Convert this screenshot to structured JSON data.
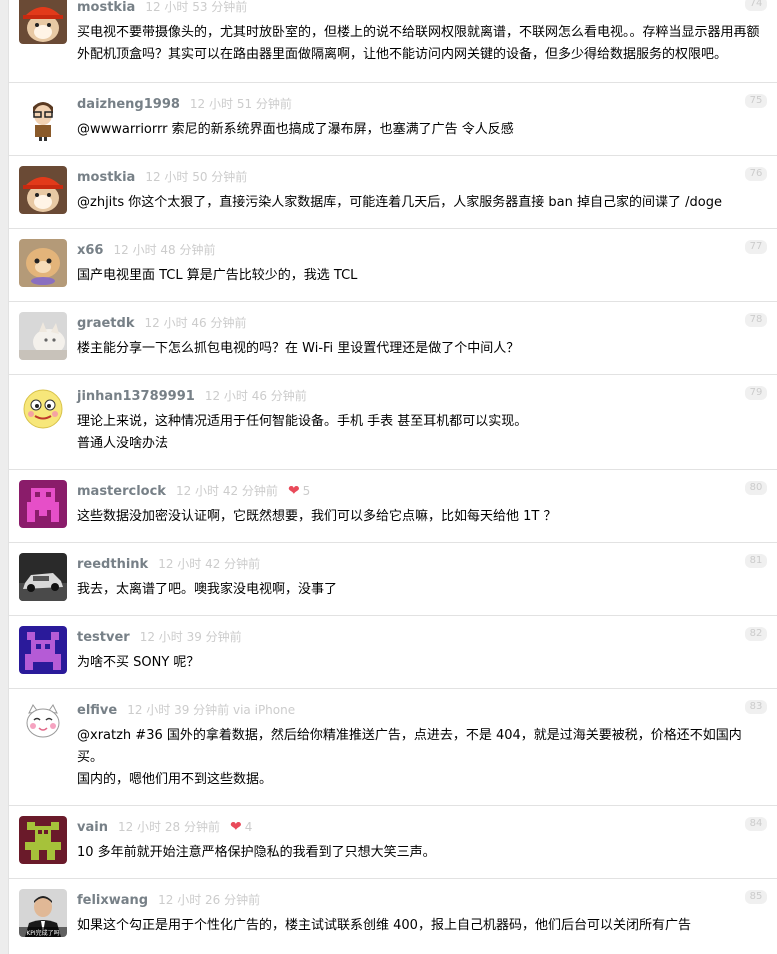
{
  "replies": [
    {
      "number": "74",
      "username": "mostkia",
      "time": "12 小时 53 分钟前",
      "avatar": "shiba-hardhat-avatar",
      "lines": [
        "买电视不要带摄像头的，尤其时放卧室的，但楼上的说不给联网权限就离谱，不联网怎么看电视。。存粹当显示器用再额外配机顶盒吗？其实可以在路由器里面做隔离啊，让他不能访问内网关键的设备，但多少得给数据服务的权限吧。"
      ]
    },
    {
      "number": "75",
      "username": "daizheng1998",
      "time": "12 小时 51 分钟前",
      "avatar": "cartoon-person-avatar",
      "lines": [
        "@wwwarriorrr 索尼的新系统界面也搞成了瀑布屏，也塞满了广告 令人反感"
      ]
    },
    {
      "number": "76",
      "username": "mostkia",
      "time": "12 小时 50 分钟前",
      "avatar": "shiba-hardhat-avatar",
      "lines": [
        "@zhjits 你这个太狠了，直接污染人家数据库，可能连着几天后，人家服务器直接 ban 掉自己家的间谍了 /doge"
      ]
    },
    {
      "number": "77",
      "username": "x66",
      "time": "12 小时 48 分钟前",
      "avatar": "puppy-photo-avatar",
      "lines": [
        "国产电视里面 TCL 算是广告比较少的，我选 TCL"
      ]
    },
    {
      "number": "78",
      "username": "graetdk",
      "time": "12 小时 46 分钟前",
      "avatar": "cat-photo-avatar",
      "lines": [
        "楼主能分享一下怎么抓包电视的吗？在 Wi-Fi 里设置代理还是做了个中间人？"
      ]
    },
    {
      "number": "79",
      "username": "jinhan13789991",
      "time": "12 小时 46 分钟前",
      "avatar": "smiley-face-avatar",
      "lines": [
        "理论上来说，这种情况适用于任何智能设备。手机 手表 甚至耳机都可以实现。",
        "普通人没啥办法"
      ]
    },
    {
      "number": "80",
      "username": "masterclock",
      "time": "12 小时 42 分钟前",
      "avatar": "pixel-purple-avatar",
      "likes": "5",
      "lines": [
        "这些数据没加密没认证啊，它既然想要，我们可以多给它点嘛，比如每天给他 1T ？"
      ]
    },
    {
      "number": "81",
      "username": "reedthink",
      "time": "12 小时 42 分钟前",
      "avatar": "car-photo-avatar",
      "lines": [
        "我去，太离谱了吧。噢我家没电视啊，没事了"
      ]
    },
    {
      "number": "82",
      "username": "testver",
      "time": "12 小时 39 分钟前",
      "avatar": "pixel-blue-avatar",
      "lines": [
        "为啥不买 SONY 呢？"
      ]
    },
    {
      "number": "83",
      "username": "elfive",
      "time": "12 小时 39 分钟前 via iPhone",
      "avatar": "cartoon-cat-avatar",
      "lines": [
        "@xratzh #36 国外的拿着数据，然后给你精准推送广告，点进去，不是 404，就是过海关要被税，价格还不如国内买。",
        "国内的，嗯他们用不到这些数据。"
      ]
    },
    {
      "number": "84",
      "username": "vain",
      "time": "12 小时 28 分钟前",
      "avatar": "pixel-green-avatar",
      "likes": "4",
      "lines": [
        "10 多年前就开始注意严格保护隐私的我看到了只想大笑三声。"
      ]
    },
    {
      "number": "85",
      "username": "felixwang",
      "time": "12 小时 26 分钟前",
      "avatar": "person-photo-avatar",
      "avatar_caption": "KPI完成了吗",
      "lines": [
        "如果这个勾正是用于个性化广告的，楼主试试联系创维 400，报上自己机器码，他们后台可以关闭所有广告"
      ]
    }
  ]
}
